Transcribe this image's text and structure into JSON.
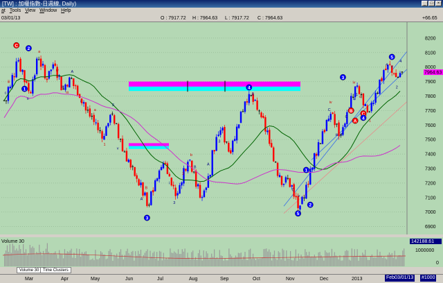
{
  "window": {
    "title": "[TW] : 加權指數-日週線, Daily)"
  },
  "menu": [
    "at",
    "Tools",
    "View",
    "Window",
    "Help"
  ],
  "info": {
    "date": "03/01/13",
    "open": "O : 7917.72",
    "high": "H : 7964.63",
    "low": "L : 7917.72",
    "close": "C : 7964.63",
    "change": "+66.65"
  },
  "tabs": [
    "Volume 30",
    "Time Clusters"
  ],
  "volume_panel": {
    "title": "Volume 30",
    "last": "142188.61",
    "tick_1000000": "1000000",
    "tick_0": "0"
  },
  "corner": "#1000",
  "x_axis": {
    "date_box": "Feb03/01/13"
  },
  "colors": {
    "bg": "#b4d8b4",
    "up": "#0000ff",
    "down": "#ff0000",
    "neutral": "#000000",
    "ma_long": "#006400",
    "ma_mid": "#cc33cc",
    "magenta": "#ff00ff",
    "cyan": "#00ffff"
  },
  "chart_data": {
    "type": "candlestick",
    "ylabel": "",
    "ylim": [
      6850,
      8300
    ],
    "y_ticks": [
      6900,
      7000,
      7100,
      7200,
      7300,
      7400,
      7500,
      7600,
      7700,
      7800,
      7900,
      8000,
      8100,
      8200
    ],
    "x_ticks": [
      "Mar",
      "Apr",
      "May",
      "Jun",
      "Jul",
      "Aug",
      "Sep",
      "Oct",
      "Nov",
      "Dec",
      "2013"
    ],
    "last_value": "7964.63",
    "close_path": [
      [
        0,
        7770
      ],
      [
        3,
        7860
      ],
      [
        6,
        7940
      ],
      [
        9,
        8050
      ],
      [
        12,
        7980
      ],
      [
        15,
        7900
      ],
      [
        18,
        7830
      ],
      [
        21,
        7930
      ],
      [
        24,
        8060
      ],
      [
        27,
        8010
      ],
      [
        30,
        7920
      ],
      [
        33,
        7980
      ],
      [
        36,
        8020
      ],
      [
        39,
        7940
      ],
      [
        42,
        7850
      ],
      [
        45,
        7880
      ],
      [
        48,
        7920
      ],
      [
        51,
        7870
      ],
      [
        54,
        7800
      ],
      [
        57,
        7760
      ],
      [
        60,
        7700
      ],
      [
        63,
        7660
      ],
      [
        66,
        7620
      ],
      [
        69,
        7560
      ],
      [
        72,
        7520
      ],
      [
        75,
        7600
      ],
      [
        78,
        7680
      ],
      [
        81,
        7600
      ],
      [
        84,
        7510
      ],
      [
        87,
        7420
      ],
      [
        90,
        7360
      ],
      [
        93,
        7300
      ],
      [
        96,
        7240
      ],
      [
        99,
        7190
      ],
      [
        102,
        7120
      ],
      [
        105,
        7040
      ],
      [
        108,
        7140
      ],
      [
        111,
        7220
      ],
      [
        114,
        7300
      ],
      [
        117,
        7340
      ],
      [
        120,
        7260
      ],
      [
        123,
        7180
      ],
      [
        126,
        7120
      ],
      [
        129,
        7200
      ],
      [
        132,
        7300
      ],
      [
        135,
        7360
      ],
      [
        138,
        7290
      ],
      [
        141,
        7180
      ],
      [
        144,
        7100
      ],
      [
        147,
        7160
      ],
      [
        150,
        7260
      ],
      [
        153,
        7420
      ],
      [
        156,
        7520
      ],
      [
        159,
        7570
      ],
      [
        162,
        7490
      ],
      [
        165,
        7420
      ],
      [
        168,
        7500
      ],
      [
        171,
        7600
      ],
      [
        174,
        7700
      ],
      [
        177,
        7770
      ],
      [
        180,
        7800
      ],
      [
        183,
        7760
      ],
      [
        186,
        7700
      ],
      [
        189,
        7640
      ],
      [
        192,
        7560
      ],
      [
        195,
        7460
      ],
      [
        198,
        7350
      ],
      [
        201,
        7260
      ],
      [
        204,
        7200
      ],
      [
        207,
        7230
      ],
      [
        210,
        7180
      ],
      [
        213,
        7100
      ],
      [
        216,
        7030
      ],
      [
        219,
        7090
      ],
      [
        222,
        7200
      ],
      [
        225,
        7300
      ],
      [
        228,
        7400
      ],
      [
        231,
        7480
      ],
      [
        234,
        7560
      ],
      [
        237,
        7630
      ],
      [
        240,
        7680
      ],
      [
        243,
        7600
      ],
      [
        246,
        7530
      ],
      [
        249,
        7600
      ],
      [
        252,
        7700
      ],
      [
        255,
        7790
      ],
      [
        258,
        7860
      ],
      [
        261,
        7810
      ],
      [
        264,
        7730
      ],
      [
        267,
        7680
      ],
      [
        270,
        7760
      ],
      [
        273,
        7830
      ],
      [
        276,
        7910
      ],
      [
        279,
        7980
      ],
      [
        282,
        8010
      ],
      [
        285,
        7960
      ],
      [
        288,
        7930
      ],
      [
        291,
        7960
      ]
    ],
    "wave_labels": [
      {
        "t": 0,
        "label": "C",
        "color": "red"
      },
      {
        "t": 0,
        "label": "2",
        "color": "blue"
      },
      {
        "t": 0,
        "label": "1",
        "color": "blue"
      },
      {
        "t": 0,
        "label": "3",
        "color": "blue"
      },
      {
        "t": 0,
        "label": "4",
        "color": "blue"
      },
      {
        "t": 0,
        "label": "5",
        "color": "blue"
      },
      {
        "t": 0,
        "label": "1",
        "color": "blue"
      },
      {
        "t": 0,
        "label": "2",
        "color": "blue"
      },
      {
        "t": 0,
        "label": "3",
        "color": "blue"
      },
      {
        "t": 0,
        "label": "4",
        "color": "blue"
      },
      {
        "t": 0,
        "label": "5",
        "color": "blue"
      },
      {
        "t": 0,
        "label": "B",
        "color": "red"
      },
      {
        "t": 0,
        "label": "A",
        "color": "red"
      },
      {
        "t": 0,
        "label": "C",
        "color": "red"
      },
      {
        "t": 0,
        "label": "4",
        "color": "blue"
      },
      {
        "t": 0,
        "label": "5",
        "color": "blue"
      }
    ],
    "small_labels": [
      "iii",
      "iv",
      "v",
      "3",
      "4",
      "2",
      "1",
      "A",
      "B",
      "C",
      "a",
      "b",
      "c",
      "i",
      "ii"
    ],
    "volume": []
  }
}
